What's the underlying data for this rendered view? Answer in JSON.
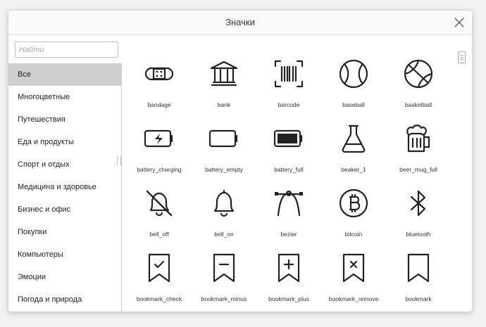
{
  "dialog": {
    "title": "Значки",
    "search_placeholder": "Найти"
  },
  "categories": [
    {
      "label": "Все",
      "active": true
    },
    {
      "label": "Многоцветные"
    },
    {
      "label": "Путешествия"
    },
    {
      "label": "Еда и продукты"
    },
    {
      "label": "Спорт и отдых"
    },
    {
      "label": "Медицина и здоровье"
    },
    {
      "label": "Бизнес и офис"
    },
    {
      "label": "Покупки"
    },
    {
      "label": "Компьютеры"
    },
    {
      "label": "Эмоции"
    },
    {
      "label": "Погода и природа"
    }
  ],
  "icons": [
    {
      "label": "bandage",
      "icon": "bandage-icon"
    },
    {
      "label": "bank",
      "icon": "bank-icon"
    },
    {
      "label": "barcode",
      "icon": "barcode-icon"
    },
    {
      "label": "baseball",
      "icon": "baseball-icon"
    },
    {
      "label": "basketball",
      "icon": "basketball-icon"
    },
    {
      "label": "battery_charging",
      "icon": "battery-charging-icon"
    },
    {
      "label": "battery_empty",
      "icon": "battery-empty-icon"
    },
    {
      "label": "battery_full",
      "icon": "battery-full-icon"
    },
    {
      "label": "beaker_1",
      "icon": "beaker-icon"
    },
    {
      "label": "beer_mug_full",
      "icon": "beer-mug-icon"
    },
    {
      "label": "bell_off",
      "icon": "bell-off-icon"
    },
    {
      "label": "bell_on",
      "icon": "bell-icon"
    },
    {
      "label": "bezier",
      "icon": "bezier-icon"
    },
    {
      "label": "bitcoin",
      "icon": "bitcoin-icon"
    },
    {
      "label": "bluetooth",
      "icon": "bluetooth-icon"
    },
    {
      "label": "bookmark_check",
      "icon": "bookmark-check-icon"
    },
    {
      "label": "bookmark_minus",
      "icon": "bookmark-minus-icon"
    },
    {
      "label": "bookmark_plus",
      "icon": "bookmark-plus-icon"
    },
    {
      "label": "bookmark_remove",
      "icon": "bookmark-remove-icon"
    },
    {
      "label": "bookmark",
      "icon": "bookmark-icon"
    }
  ]
}
